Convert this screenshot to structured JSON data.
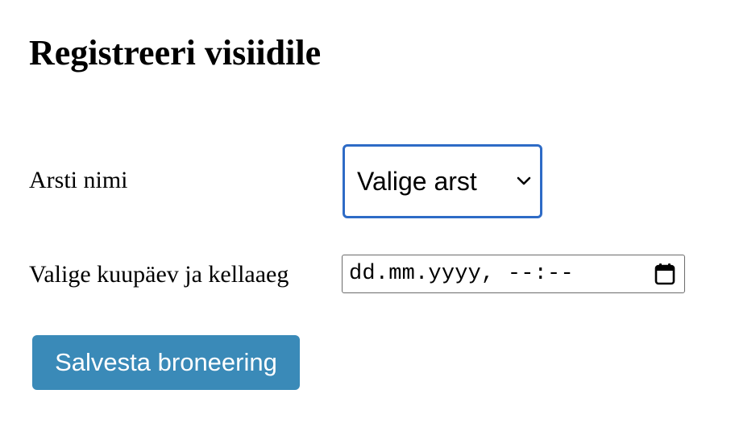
{
  "page": {
    "title": "Registreeri visiidile"
  },
  "form": {
    "doctor": {
      "label": "Arsti nimi",
      "selected": "Valige arst",
      "chevron_icon": "chevron-down-icon"
    },
    "datetime": {
      "label": "Valige kuupäev ja kellaaeg",
      "value": "dd.mm.yyyy, --:--",
      "calendar_icon": "calendar-icon"
    },
    "submit_label": "Salvesta broneering"
  },
  "colors": {
    "select_focus_border": "#2e6bc6",
    "button_background": "#3a8ab8",
    "button_text": "#ffffff"
  }
}
